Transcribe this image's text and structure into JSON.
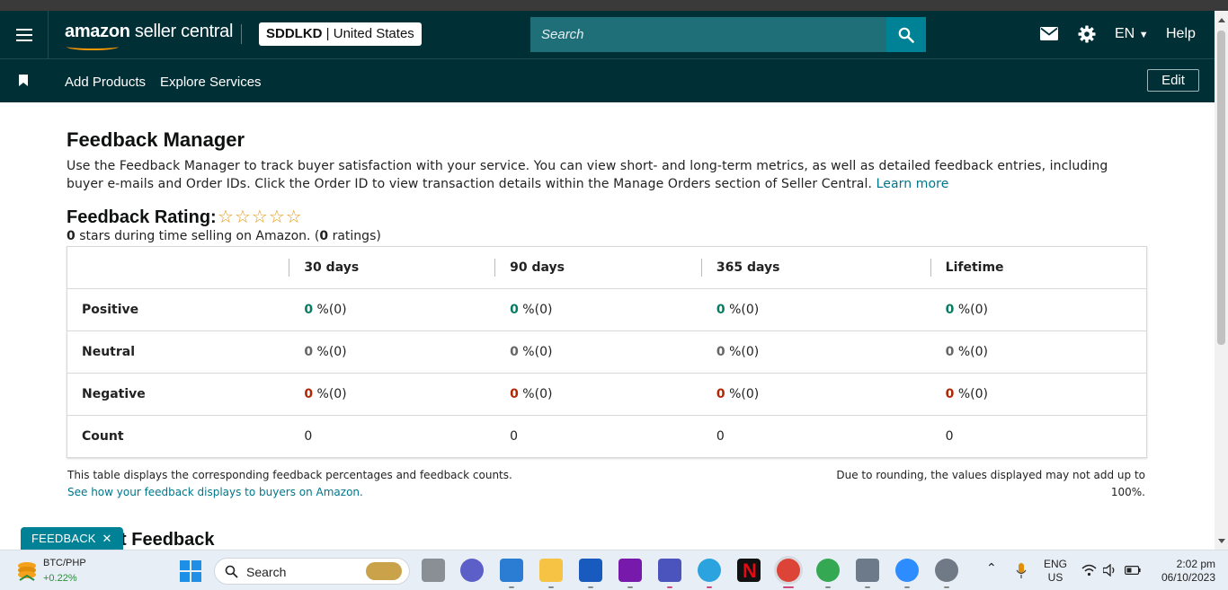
{
  "header": {
    "logo_bold": "amazon",
    "logo_rest": " seller central",
    "store_code": "SDDLKD",
    "store_region": " | United States",
    "search_placeholder": "Search",
    "language": "EN",
    "help": "Help"
  },
  "subnav": {
    "links": [
      "Add Products",
      "Explore Services"
    ],
    "edit": "Edit"
  },
  "main": {
    "title": "Feedback Manager",
    "intro": "Use the Feedback Manager to track buyer satisfaction with your service. You can view short- and long-term metrics, as well as detailed feedback entries, including buyer e-mails and Order IDs. Click the Order ID to view transaction details within the Manage Orders section of Seller Central.",
    "learn_more": "Learn more",
    "rating_title": "Feedback Rating:",
    "rating_stars": 0,
    "rating_stars_max": 5,
    "rating_stars_count": "0",
    "rating_sub_mid": " stars during time selling on Amazon. (",
    "rating_count": "0",
    "rating_sub_end": " ratings)",
    "table": {
      "columns": [
        "30 days",
        "90 days",
        "365 days",
        "Lifetime"
      ],
      "rows": [
        {
          "label": "Positive",
          "cells": [
            {
              "v": "0",
              "s": " %(0)"
            },
            {
              "v": "0",
              "s": " %(0)"
            },
            {
              "v": "0",
              "s": " %(0)"
            },
            {
              "v": "0",
              "s": " %(0)"
            }
          ]
        },
        {
          "label": "Neutral",
          "cells": [
            {
              "v": "0",
              "s": " %(0)"
            },
            {
              "v": "0",
              "s": " %(0)"
            },
            {
              "v": "0",
              "s": " %(0)"
            },
            {
              "v": "0",
              "s": " %(0)"
            }
          ]
        },
        {
          "label": "Negative",
          "cells": [
            {
              "v": "0",
              "s": " %(0)"
            },
            {
              "v": "0",
              "s": " %(0)"
            },
            {
              "v": "0",
              "s": " %(0)"
            },
            {
              "v": "0",
              "s": " %(0)"
            }
          ]
        },
        {
          "label": "Count",
          "cells": [
            "0",
            "0",
            "0",
            "0"
          ]
        }
      ]
    },
    "note_left": "This table displays the corresponding feedback percentages and feedback counts.",
    "note_link": "See how your feedback displays to buyers on Amazon.",
    "note_right": "Due to rounding, the values displayed may not add up to 100%.",
    "recent_title": "Recent Feedback",
    "feedback_tab": "FEEDBACK"
  },
  "taskbar": {
    "ticker_name": "BTC/PHP",
    "ticker_change": "+0.22%",
    "search": "Search",
    "lang_top": "ENG",
    "lang_bottom": "US",
    "time": "2:02 pm",
    "date": "06/10/2023"
  },
  "colors": {
    "nav_bg": "#002f36",
    "search_bg": "#1f6f78",
    "accent": "#008296",
    "positive": "#067d62",
    "negative": "#b12704",
    "star": "#e59c19"
  }
}
